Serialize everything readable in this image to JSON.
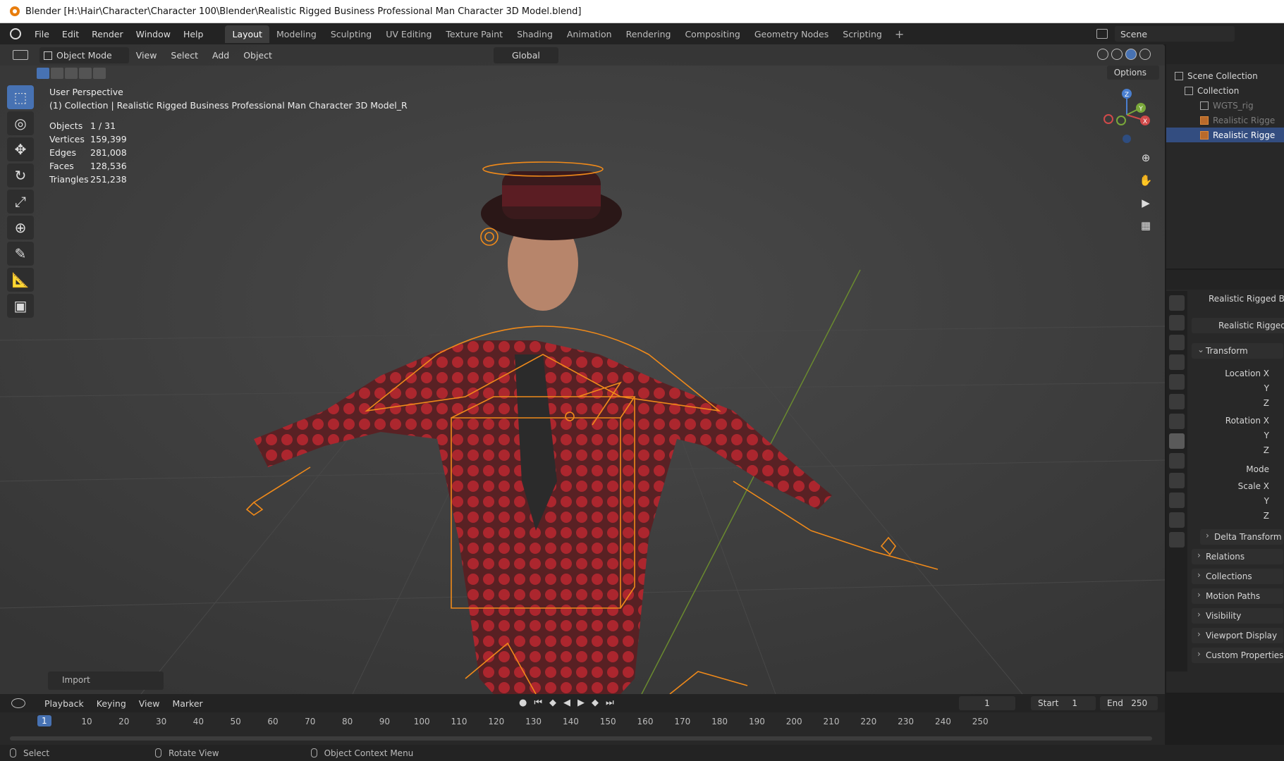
{
  "window": {
    "title": "Blender [H:\\Hair\\Character\\Character 100\\Blender\\Realistic Rigged Business Professional Man Character 3D Model.blend]"
  },
  "menubar": {
    "items": [
      "File",
      "Edit",
      "Render",
      "Window",
      "Help"
    ],
    "workspaces": [
      "Layout",
      "Modeling",
      "Sculpting",
      "UV Editing",
      "Texture Paint",
      "Shading",
      "Animation",
      "Rendering",
      "Compositing",
      "Geometry Nodes",
      "Scripting"
    ],
    "active_workspace": "Layout",
    "scene": "Scene"
  },
  "viewport": {
    "mode": "Object Mode",
    "menus": [
      "View",
      "Select",
      "Add",
      "Object"
    ],
    "orientation": "Global",
    "options": "Options",
    "perspective": "User Perspective",
    "collection_line": "(1) Collection | Realistic Rigged Business Professional Man Character 3D Model_R",
    "stats": [
      {
        "label": "Objects",
        "value": "1 / 31"
      },
      {
        "label": "Vertices",
        "value": "159,399"
      },
      {
        "label": "Edges",
        "value": "281,008"
      },
      {
        "label": "Faces",
        "value": "128,536"
      },
      {
        "label": "Triangles",
        "value": "251,238"
      }
    ],
    "import_panel": "Import",
    "gizmo": {
      "z": "Z",
      "y": "Y",
      "x": "X"
    }
  },
  "outliner": {
    "rows": [
      {
        "label": "Scene Collection"
      },
      {
        "label": "Collection"
      },
      {
        "label": "WGTS_rig"
      },
      {
        "label": "Realistic Rigge"
      },
      {
        "label": "Realistic Rigge"
      }
    ]
  },
  "properties": {
    "object_name": "Realistic Rigged Bus",
    "data_name": "Realistic Rigged",
    "transform": "Transform",
    "location_x": "Location X",
    "rotation_x": "Rotation X",
    "axis_y": "Y",
    "axis_z": "Z",
    "mode": "Mode",
    "scale_x": "Scale X",
    "sections": [
      "Delta Transform",
      "Relations",
      "Collections",
      "Motion Paths",
      "Visibility",
      "Viewport Display",
      "Custom Properties"
    ]
  },
  "timeline": {
    "menus": [
      "Playback",
      "Keying",
      "View",
      "Marker"
    ],
    "current_frame": "1",
    "start_label": "Start",
    "start": "1",
    "end_label": "End",
    "end": "250",
    "ticks": [
      "10",
      "20",
      "30",
      "40",
      "50",
      "60",
      "70",
      "80",
      "90",
      "100",
      "110",
      "120",
      "130",
      "140",
      "150",
      "160",
      "170",
      "180",
      "190",
      "200",
      "210",
      "220",
      "230",
      "240",
      "250"
    ]
  },
  "statusbar": {
    "items": [
      "Select",
      "Rotate View",
      "Object Context Menu"
    ]
  }
}
